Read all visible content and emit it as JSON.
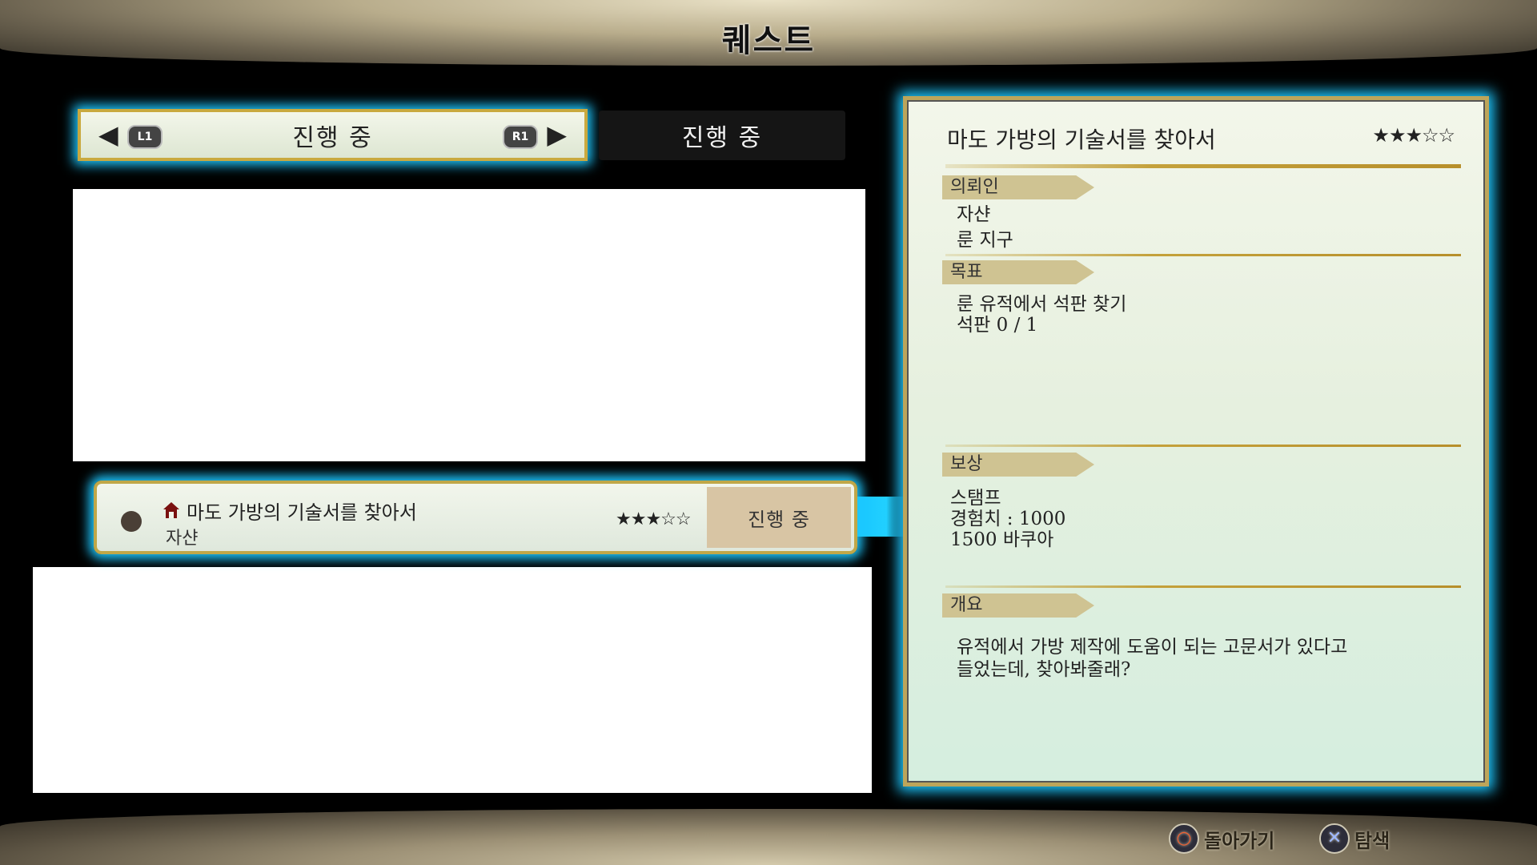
{
  "screen": {
    "title": "퀘스트"
  },
  "tabs": {
    "active_label": "진행 중",
    "left_button": "L1",
    "right_button": "R1",
    "inactive_label": "진행 중"
  },
  "quest_list": [
    {
      "name": "마도 가방의 기술서를 찾아서",
      "giver": "자샨",
      "stars": "★★★☆☆",
      "status": "진행 중"
    }
  ],
  "detail": {
    "title": "마도 가방의 기술서를 찾아서",
    "stars": "★★★☆☆",
    "client": {
      "label": "의뢰인",
      "name": "자샨",
      "location": "룬 지구"
    },
    "objective": {
      "label": "목표",
      "line1": "룬 유적에서 석판 찾기",
      "line2": "석판 0 / 1"
    },
    "reward": {
      "label": "보상",
      "line1": "스탬프",
      "line2": "경험치 : 1000",
      "line3": "1500 바쿠아"
    },
    "summary": {
      "label": "개요",
      "line1": "유적에서 가방 제작에 도움이 되는 고문서가 있다고",
      "line2": "들었는데, 찾아봐줄래?"
    }
  },
  "footer": {
    "back_label": "돌아가기",
    "explore_label": "탐색",
    "back_icon": "circle-button-icon",
    "explore_icon": "cross-button-icon"
  },
  "colors": {
    "highlight_glow": "#1ec8ff",
    "gold_border": "#c0a748",
    "panel_bg": "#e6f0df"
  }
}
